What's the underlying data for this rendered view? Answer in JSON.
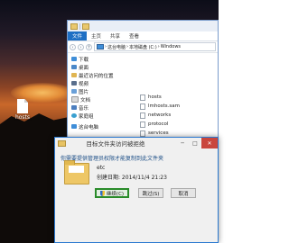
{
  "desktop": {
    "icon_label": "hosts"
  },
  "explorer": {
    "menus": [
      "文件",
      "主页",
      "共享",
      "查看"
    ],
    "address": [
      "这台电脑",
      "本地磁盘 (C:)",
      "Windows"
    ],
    "nav_items": [
      "下载",
      "桌面",
      "最近访问的位置",
      "视频",
      "图片",
      "文档",
      "音乐",
      "家庭组",
      "这台电脑"
    ],
    "files": [
      "hosts",
      "lmhosts.sam",
      "networks",
      "protocol",
      "services"
    ]
  },
  "dialog": {
    "title": "目标文件夹访问被拒绝",
    "minimize": "─",
    "maximize": "□",
    "close": "✕",
    "message": "你需要提供管理员权限才能复制到此文件夹",
    "folder_name": "etc",
    "created": "创建日期: 2014/11/4 21:23",
    "buttons": {
      "continue": "继续(C)",
      "skip": "跳过(S)",
      "cancel": "取消"
    }
  },
  "colors": {
    "accent": "#1e6fc4",
    "close_red": "#c9463d",
    "continue_border": "#2a8b2a"
  }
}
